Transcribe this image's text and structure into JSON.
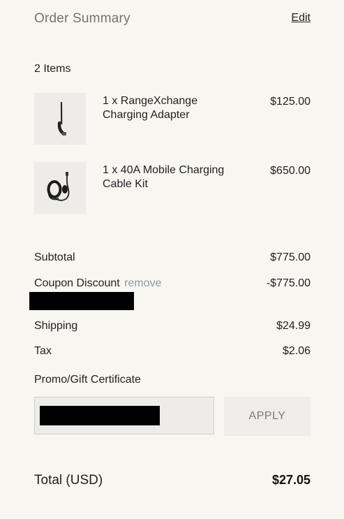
{
  "summary": {
    "title": "Order Summary",
    "edit_label": "Edit",
    "items_count": "2 Items"
  },
  "items": [
    {
      "name": "1 x RangeXchange Charging Adapter",
      "price": "$125.00",
      "image_icon": "charging-adapter-image"
    },
    {
      "name": "1 x 40A Mobile Charging Cable Kit",
      "price": "$650.00",
      "image_icon": "charging-cable-kit-image"
    }
  ],
  "totals": {
    "subtotal_label": "Subtotal",
    "subtotal_value": "$775.00",
    "discount_label": "Coupon Discount",
    "remove_label": "remove",
    "discount_value": "-$775.00",
    "shipping_label": "Shipping",
    "shipping_value": "$24.99",
    "tax_label": "Tax",
    "tax_value": "$2.06"
  },
  "promo": {
    "label": "Promo/Gift Certificate",
    "input_value": "",
    "apply_label": "APPLY"
  },
  "total": {
    "label": "Total (USD)",
    "value": "$27.05"
  }
}
